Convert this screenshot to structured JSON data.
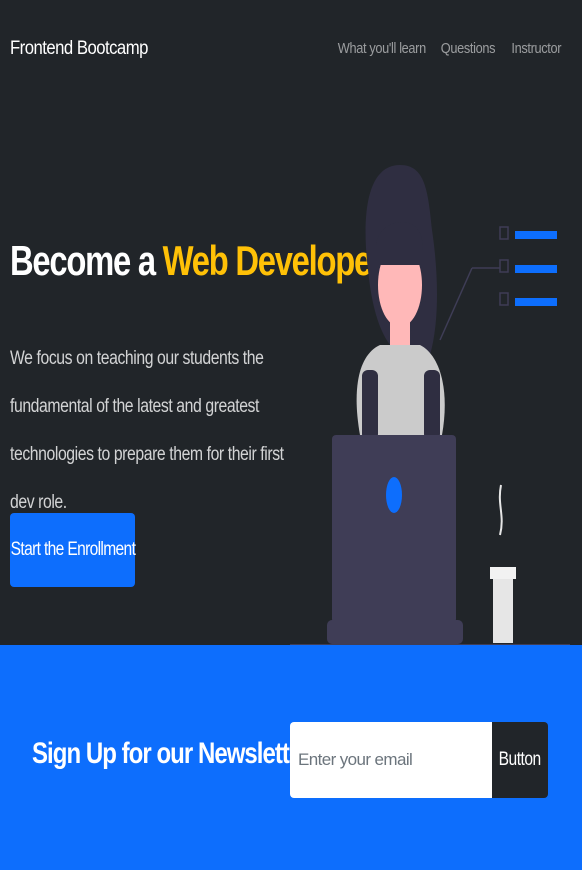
{
  "navbar": {
    "brand": "Frontend Bootcamp",
    "links": [
      "What you'll learn",
      "Questions",
      "Instructor"
    ]
  },
  "hero": {
    "title_prefix": "Become a",
    "title_accent": "Web Developer",
    "description": "We focus on teaching our students the fundamental of the latest and greatest technologies to prepare them for their first dev role.",
    "cta_label": "Start the Enrollment"
  },
  "newsletter": {
    "title": "Sign Up for our Newsletter",
    "email_placeholder": "Enter your email",
    "button_label": "Button"
  },
  "colors": {
    "dark": "#212529",
    "primary": "#0d6efd",
    "accent": "#ffc107",
    "illustration_skin": "#ffb8b8",
    "illustration_hair": "#2f2e41",
    "illustration_laptop": "#3f3d56"
  },
  "illustration": {
    "name": "woman-at-laptop-illustration"
  }
}
